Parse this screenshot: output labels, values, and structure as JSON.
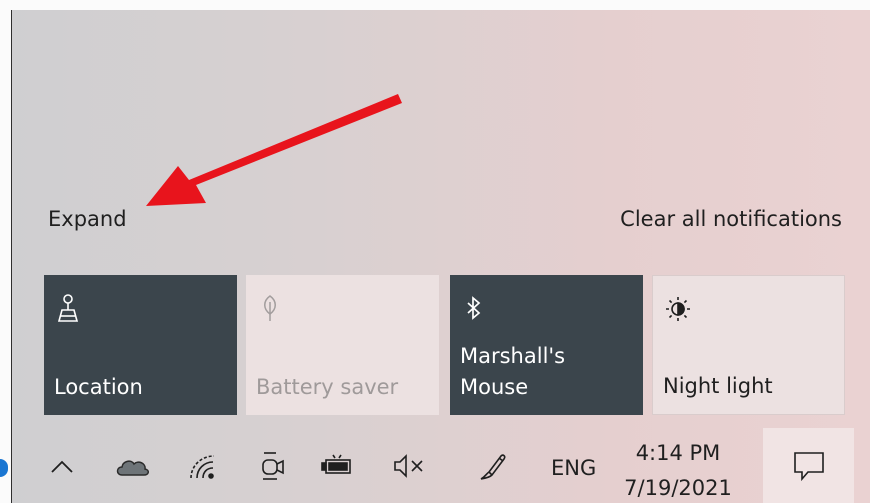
{
  "header": {
    "expand_label": "Expand",
    "clear_label": "Clear all notifications"
  },
  "quick_actions": [
    {
      "label": "Location",
      "icon": "location-icon",
      "state": "on"
    },
    {
      "label": "Battery saver",
      "icon": "battery-saver-icon",
      "state": "disabled"
    },
    {
      "label": "Marshall's\nMouse",
      "icon": "bluetooth-icon",
      "state": "on"
    },
    {
      "label": "Night light",
      "icon": "night-light-icon",
      "state": "off"
    }
  ],
  "taskbar": {
    "language": "ENG",
    "time": "4:14 PM",
    "date": "7/19/2021",
    "icons": [
      "chevron-up-icon",
      "onedrive-cloud-icon",
      "wifi-icon",
      "meet-now-icon",
      "battery-icon",
      "volume-muted-icon",
      "pen-icon",
      "action-center-icon"
    ]
  },
  "annotation": {
    "arrow_color": "#e8141c"
  },
  "colors": {
    "tile_on": "#3b454c",
    "tile_off": "#ece1e1"
  }
}
